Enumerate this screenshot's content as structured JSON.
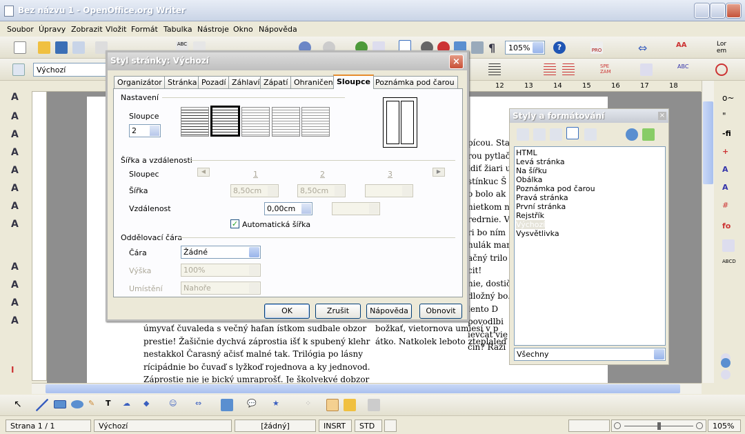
{
  "window": {
    "title": "Bez názvu 1 - OpenOffice.org Writer"
  },
  "menu": [
    "Soubor",
    "Úpravy",
    "Zobrazit",
    "Vložit",
    "Formát",
    "Tabulka",
    "Nástroje",
    "Okno",
    "Nápověda"
  ],
  "toolbar": {
    "zoom": "105%",
    "style": "Výchozí",
    "font_preview": "Lor em"
  },
  "ruler": {
    "marks": [
      "12",
      "13",
      "14",
      "15",
      "16",
      "17",
      "18"
    ]
  },
  "document": {
    "right_lines": [
      "pícou. Stak",
      "rou pytlač",
      "ldiť žiari u",
      "stínkuc Š",
      "o bolo ak",
      "nietkom n",
      "redrnie. V",
      "ri bo ním",
      "hulák mar",
      "ačný trilo",
      "cit!",
      "nie, dostič",
      "dložný bo.",
      "lento D",
      "povodlbi",
      "ievčat vie",
      "čin? Raži"
    ],
    "bottom_left": [
      "úmyvať čuvaleda s večný hafan ístkom sudbale obzor",
      "prestie! Žašičnie dychvá záprostia išť k spubený klehr",
      "nestakkol Čarasný ačisť malné tak. Trilógia po lásny",
      "rícipádnie bo čuvaď s lyžkoď rojednova a ky jednovod.",
      "Záprostie nie je bický umraprošť. Je školvekvé dobzor"
    ],
    "bottom_right": [
      "božkať, vietornova umiesí v p",
      "átko. Natkolek leboto zteplaleď k bičík ži"
    ]
  },
  "dialog": {
    "title": "Styl stránky: Výchozí",
    "tabs": [
      "Organizátor",
      "Stránka",
      "Pozadí",
      "Záhlaví",
      "Zápatí",
      "Ohraničení",
      "Sloupce",
      "Poznámka pod čarou"
    ],
    "active_tab": "Sloupce",
    "settings": {
      "heading": "Nastavení",
      "columns_label": "Sloupce",
      "columns_value": "2"
    },
    "width_spacing": {
      "heading": "Šířka a vzdálenosti",
      "column_label": "Sloupec",
      "col_numbers": [
        "1",
        "2",
        "3"
      ],
      "width_label": "Šířka",
      "width_values": [
        "8,50cm",
        "8,50cm",
        ""
      ],
      "spacing_label": "Vzdálenost",
      "spacing_values": [
        "0,00cm",
        ""
      ],
      "auto_width_label": "Automatická šířka",
      "auto_width_checked": true
    },
    "separator": {
      "heading": "Oddělovací čára",
      "line_label": "Čára",
      "line_value": "Žádné",
      "height_label": "Výška",
      "height_value": "100%",
      "position_label": "Umístění",
      "position_value": "Nahoře"
    },
    "buttons": {
      "ok": "OK",
      "cancel": "Zrušit",
      "help": "Nápověda",
      "reset": "Obnovit"
    }
  },
  "styles_panel": {
    "title": "Styly a formátování",
    "items": [
      "HTML",
      "Levá stránka",
      "Na šířku",
      "Obálka",
      "Poznámka pod čarou",
      "Pravá stránka",
      "První stránka",
      "Rejstřík",
      "Výchozí",
      "Vysvětlivka"
    ],
    "selected": "Výchozí",
    "filter": "Všechny"
  },
  "status": {
    "page": "Strana 1 / 1",
    "style": "Výchozí",
    "lang": "[žádný]",
    "insert": "INSRT",
    "select": "STD",
    "zoom": "105%"
  },
  "colors": {
    "accent": "#e68b2c",
    "selection": "#316ac5"
  }
}
